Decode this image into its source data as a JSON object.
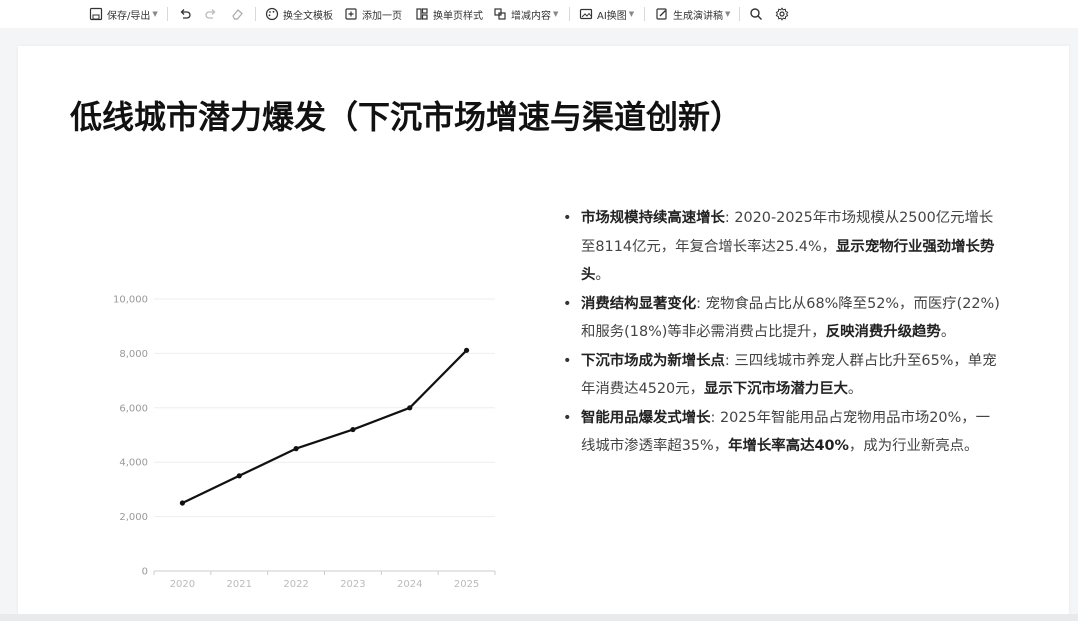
{
  "toolbar": {
    "save_label": "保存/导出",
    "template_label": "换全文模板",
    "add_page_label": "添加一页",
    "single_style_label": "换单页样式",
    "edit_content_label": "增减内容",
    "ai_image_label": "AI换图",
    "script_label": "生成演讲稿"
  },
  "slide": {
    "title": "低线城市潜力爆发（下沉市场增速与渠道创新）",
    "bullets": [
      {
        "bold_lead": "市场规模持续高速增长",
        "text": ": 2020-2025年市场规模从2500亿元增长至8114亿元，年复合增长率达25.4%，",
        "bold_tail": "显示宠物行业强劲增长势头",
        "end": "。"
      },
      {
        "bold_lead": "消费结构显著变化",
        "text": ": 宠物食品占比从68%降至52%，而医疗(22%)和服务(18%)等非必需消费占比提升，",
        "bold_tail": "反映消费升级趋势",
        "end": "。"
      },
      {
        "bold_lead": "下沉市场成为新增长点",
        "text": ": 三四线城市养宠人群占比升至65%，单宠年消费达4520元，",
        "bold_tail": "显示下沉市场潜力巨大",
        "end": "。"
      },
      {
        "bold_lead": "智能用品爆发式增长",
        "text": ": 2025年智能用品占宠物用品市场20%，一线城市渗透率超35%，",
        "bold_tail": "年增长率高达40%",
        "end": "，成为行业新亮点。"
      }
    ]
  },
  "chart_data": {
    "type": "line",
    "categories": [
      "2020",
      "2021",
      "2022",
      "2023",
      "2024",
      "2025"
    ],
    "values": [
      2500,
      3500,
      4500,
      5200,
      6000,
      8114
    ],
    "ylim": [
      0,
      10000
    ],
    "yticks": [
      0,
      2000,
      4000,
      6000,
      8000,
      10000
    ],
    "ytick_labels": [
      "0",
      "2,000",
      "4,000",
      "6,000",
      "8,000",
      "10,000"
    ],
    "grid": true,
    "title": "",
    "xlabel": "",
    "ylabel": "",
    "line_color": "#111111",
    "grid_color": "#eeeeee"
  }
}
